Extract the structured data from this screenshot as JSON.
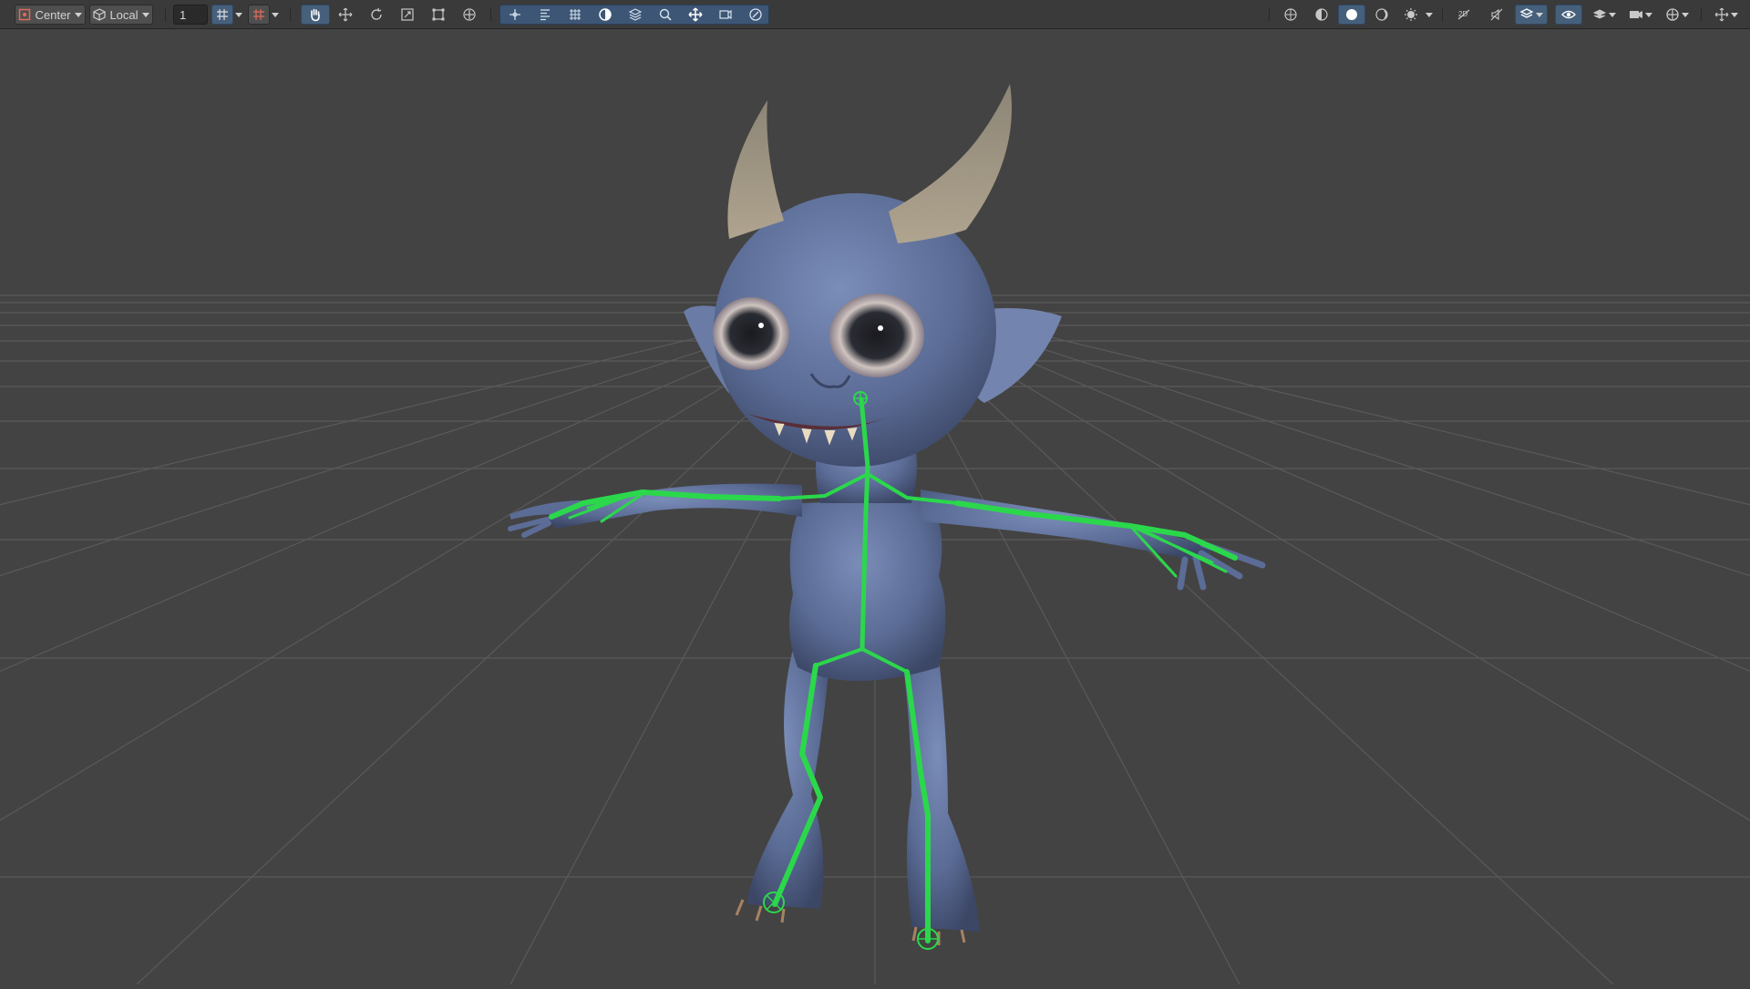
{
  "toolbar": {
    "pivot_mode": "Center",
    "pivot_space": "Local",
    "snap_increment": "1",
    "left_tools": [
      "grid-snap-icon",
      "increment-snap-icon"
    ],
    "transform_tools": [
      "hand-tool-icon",
      "move-tool-icon",
      "rotate-tool-icon",
      "scale-tool-icon",
      "rect-tool-icon",
      "transform-tool-icon"
    ],
    "custom_tools": [
      "move-bone-icon",
      "align-icon",
      "grid-icon",
      "circle-icon",
      "layers-icon",
      "zoom-icon",
      "pan-icon",
      "camera-move-icon",
      "orbit-icon"
    ],
    "right_tools": [
      "gizmo-globe-icon",
      "shaded-icon",
      "lit-icon",
      "wireframe-icon",
      "effects-icon",
      "2d-toggle-icon",
      "audio-icon",
      "scene-fx-icon",
      "visibility-icon",
      "layers-icon",
      "camera-icon",
      "gizmos-icon",
      "more-icon"
    ]
  },
  "viewport": {
    "background_color": "#434343",
    "grid_color": "#5a5a5a",
    "bone_color": "#2bd84b",
    "character_color": "#5d6f99"
  }
}
